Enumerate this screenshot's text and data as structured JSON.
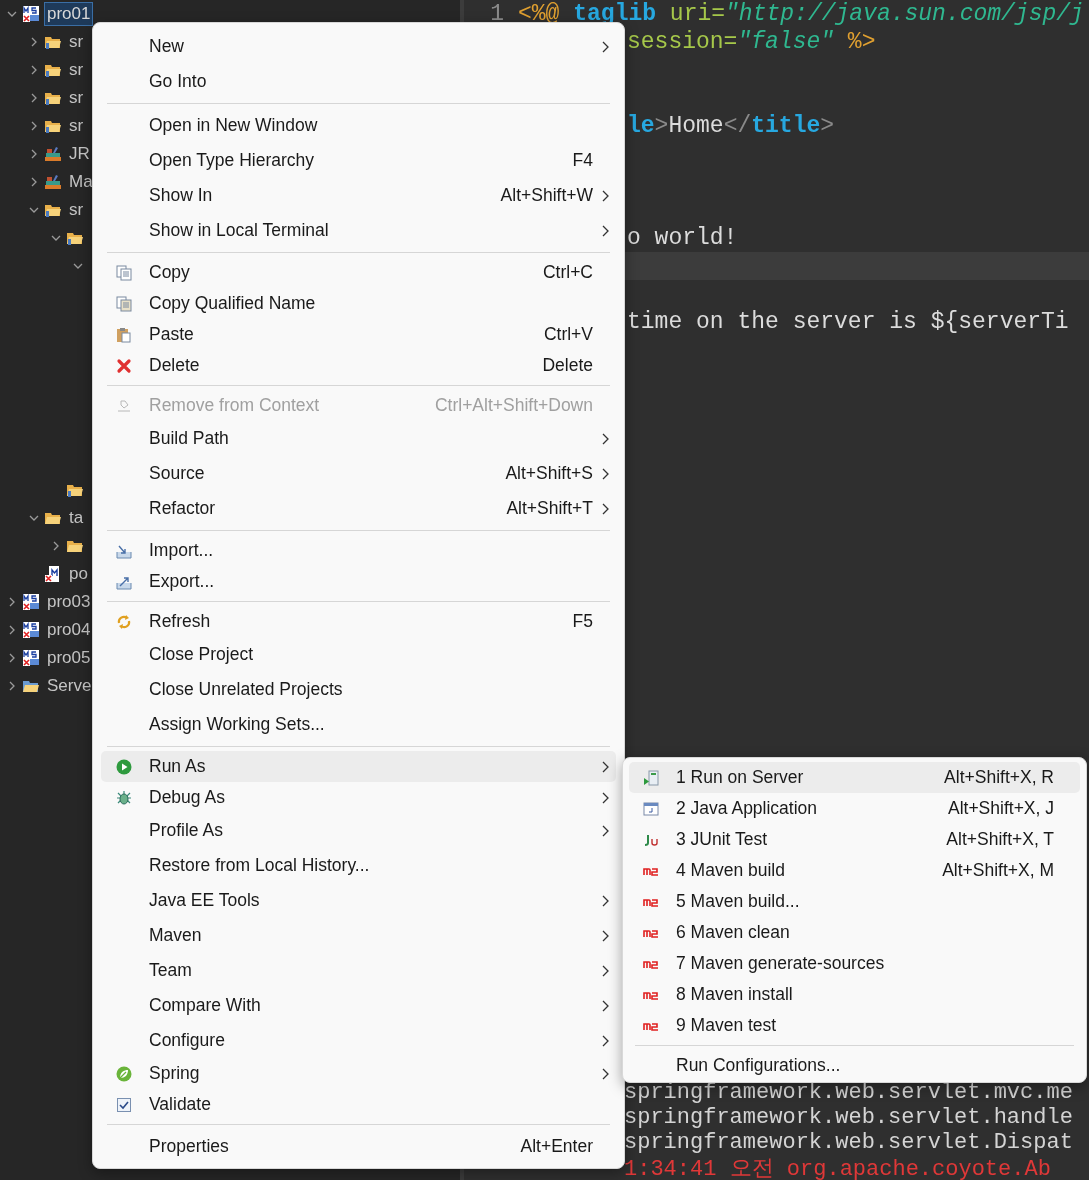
{
  "tree": [
    {
      "label": "pro01",
      "kind": "project",
      "expanded": true,
      "selected": true,
      "children": [
        {
          "label": "sr",
          "kind": "package-folder",
          "expanded": false,
          "selected": false
        },
        {
          "label": "sr",
          "kind": "package-folder",
          "expanded": false,
          "selected": false
        },
        {
          "label": "sr",
          "kind": "package-folder",
          "expanded": false,
          "selected": false
        },
        {
          "label": "sr",
          "kind": "package-folder",
          "expanded": false,
          "selected": false
        },
        {
          "label": "JR",
          "kind": "library",
          "expanded": false,
          "selected": false
        },
        {
          "label": "Ma",
          "kind": "library",
          "expanded": false,
          "selected": false
        },
        {
          "label": "sr",
          "kind": "package-folder",
          "expanded": true,
          "selected": false,
          "children": [
            {
              "kind": "package-folder",
              "expanded": true,
              "children": [
                {
                  "expanded": true
                }
              ]
            },
            {
              "kind": "package-folder"
            }
          ]
        },
        {
          "label": "ta",
          "kind": "folder",
          "expanded": true,
          "selected": false,
          "children": [
            {
              "kind": "folder",
              "expanded": false
            }
          ]
        },
        {
          "label": "po",
          "kind": "pom",
          "selected": false
        }
      ]
    },
    {
      "label": "pro03",
      "kind": "project",
      "expanded": false,
      "selected": false
    },
    {
      "label": "pro04",
      "kind": "project",
      "expanded": false,
      "selected": false
    },
    {
      "label": "pro05",
      "kind": "project",
      "expanded": false,
      "selected": false
    },
    {
      "label": "Serve",
      "kind": "servers",
      "expanded": false,
      "selected": false
    }
  ],
  "editor": {
    "lines": [
      {
        "number": "1",
        "current": false,
        "tokens": [
          {
            "text": "<%@",
            "kind": "delim"
          },
          {
            "text": " taglib",
            "kind": "keyword"
          },
          {
            "text": " uri=",
            "kind": "attr"
          },
          {
            "text": "\"http://java.sun.com/jsp/j",
            "kind": "string"
          }
        ]
      },
      {
        "current": false,
        "tokens": [
          {
            "text": "session=",
            "kind": "attr"
          },
          {
            "text": "\"false\"",
            "kind": "string"
          },
          {
            "text": " %>",
            "kind": "delim"
          }
        ]
      },
      {
        "current": false
      },
      {
        "current": false
      },
      {
        "current": false,
        "tokens": [
          {
            "text": "le",
            "kind": "keyword"
          },
          {
            "text": ">",
            "kind": "punct"
          },
          {
            "text": "Home",
            "kind": "plain"
          },
          {
            "text": "</",
            "kind": "punct"
          },
          {
            "text": "title",
            "kind": "keyword"
          },
          {
            "text": ">",
            "kind": "punct"
          }
        ]
      },
      {
        "current": false
      },
      {
        "current": false
      },
      {
        "current": false
      },
      {
        "current": false,
        "tokens": [
          {
            "text": "o world!",
            "kind": "plain"
          }
        ]
      },
      {
        "current": true
      },
      {
        "current": false
      },
      {
        "current": false,
        "tokens": [
          {
            "text": "time on the server is ${serverTi",
            "kind": "plain"
          }
        ]
      }
    ]
  },
  "console": {
    "lines": [
      {
        "text": "springframework.web.servlet.mvc.me",
        "kind": "info"
      },
      {
        "text": "springframework.web.servlet.handle",
        "kind": "info"
      },
      {
        "text": "springframework.web.servlet.Dispat",
        "kind": "info"
      },
      {
        "text": "1:34:41 오전 org.apache.coyote.Ab",
        "kind": "error"
      }
    ]
  },
  "context_menu": {
    "sections": [
      [
        {
          "label": "New",
          "submenu": true,
          "disabled": false,
          "selected": false,
          "kind": "none"
        },
        {
          "label": "Go Into",
          "submenu": false,
          "disabled": false,
          "selected": false,
          "kind": "none"
        }
      ],
      [
        {
          "label": "Open in New Window",
          "submenu": false,
          "disabled": false,
          "selected": false,
          "kind": "none"
        },
        {
          "label": "Open Type Hierarchy",
          "shortcut": "F4",
          "submenu": false,
          "disabled": false,
          "selected": false,
          "kind": "none"
        },
        {
          "label": "Show In",
          "shortcut": "Alt+Shift+W",
          "submenu": true,
          "disabled": false,
          "selected": false,
          "kind": "none"
        },
        {
          "label": "Show in Local Terminal",
          "submenu": true,
          "disabled": false,
          "selected": false,
          "kind": "none"
        }
      ],
      [
        {
          "label": "Copy",
          "shortcut": "Ctrl+C",
          "submenu": false,
          "disabled": false,
          "selected": false,
          "kind": "copy"
        },
        {
          "label": "Copy Qualified Name",
          "submenu": false,
          "disabled": false,
          "selected": false,
          "kind": "copy-name"
        },
        {
          "label": "Paste",
          "shortcut": "Ctrl+V",
          "submenu": false,
          "disabled": false,
          "selected": false,
          "kind": "paste"
        },
        {
          "label": "Delete",
          "shortcut": "Delete",
          "submenu": false,
          "disabled": false,
          "selected": false,
          "kind": "delete"
        }
      ],
      [
        {
          "label": "Remove from Context",
          "shortcut": "Ctrl+Alt+Shift+Down",
          "submenu": false,
          "disabled": true,
          "selected": false,
          "kind": "remove"
        },
        {
          "label": "Build Path",
          "submenu": true,
          "disabled": false,
          "selected": false,
          "kind": "none"
        },
        {
          "label": "Source",
          "shortcut": "Alt+Shift+S",
          "submenu": true,
          "disabled": false,
          "selected": false,
          "kind": "none"
        },
        {
          "label": "Refactor",
          "shortcut": "Alt+Shift+T",
          "submenu": true,
          "disabled": false,
          "selected": false,
          "kind": "none"
        }
      ],
      [
        {
          "label": "Import...",
          "submenu": false,
          "disabled": false,
          "selected": false,
          "kind": "import"
        },
        {
          "label": "Export...",
          "submenu": false,
          "disabled": false,
          "selected": false,
          "kind": "export"
        }
      ],
      [
        {
          "label": "Refresh",
          "shortcut": "F5",
          "submenu": false,
          "disabled": false,
          "selected": false,
          "kind": "refresh"
        },
        {
          "label": "Close Project",
          "submenu": false,
          "disabled": false,
          "selected": false,
          "kind": "none"
        },
        {
          "label": "Close Unrelated Projects",
          "submenu": false,
          "disabled": false,
          "selected": false,
          "kind": "none"
        },
        {
          "label": "Assign Working Sets...",
          "submenu": false,
          "disabled": false,
          "selected": false,
          "kind": "none"
        }
      ],
      [
        {
          "label": "Run As",
          "submenu": true,
          "disabled": false,
          "selected": true,
          "kind": "run"
        },
        {
          "label": "Debug As",
          "submenu": true,
          "disabled": false,
          "selected": false,
          "kind": "debug"
        },
        {
          "label": "Profile As",
          "submenu": true,
          "disabled": false,
          "selected": false,
          "kind": "none"
        },
        {
          "label": "Restore from Local History...",
          "submenu": false,
          "disabled": false,
          "selected": false,
          "kind": "none"
        },
        {
          "label": "Java EE Tools",
          "submenu": true,
          "disabled": false,
          "selected": false,
          "kind": "none"
        },
        {
          "label": "Maven",
          "submenu": true,
          "disabled": false,
          "selected": false,
          "kind": "none"
        },
        {
          "label": "Team",
          "submenu": true,
          "disabled": false,
          "selected": false,
          "kind": "none"
        },
        {
          "label": "Compare With",
          "submenu": true,
          "disabled": false,
          "selected": false,
          "kind": "none"
        },
        {
          "label": "Configure",
          "submenu": true,
          "disabled": false,
          "selected": false,
          "kind": "none"
        },
        {
          "label": "Spring",
          "submenu": true,
          "disabled": false,
          "selected": false,
          "kind": "spring"
        },
        {
          "label": "Validate",
          "submenu": false,
          "disabled": false,
          "selected": false,
          "kind": "validate"
        }
      ],
      [
        {
          "label": "Properties",
          "shortcut": "Alt+Enter",
          "submenu": false,
          "disabled": false,
          "selected": false,
          "kind": "none"
        }
      ]
    ]
  },
  "run_as_menu": {
    "sections": [
      [
        {
          "label": "1 Run on Server",
          "shortcut": "Alt+Shift+X, R",
          "selected": true,
          "kind": "server"
        },
        {
          "label": "2 Java Application",
          "shortcut": "Alt+Shift+X, J",
          "selected": false,
          "kind": "java"
        },
        {
          "label": "3 JUnit Test",
          "shortcut": "Alt+Shift+X, T",
          "selected": false,
          "kind": "junit"
        },
        {
          "label": "4 Maven build",
          "shortcut": "Alt+Shift+X, M",
          "selected": false,
          "kind": "maven"
        },
        {
          "label": "5 Maven build...",
          "selected": false,
          "kind": "maven"
        },
        {
          "label": "6 Maven clean",
          "selected": false,
          "kind": "maven"
        },
        {
          "label": "7 Maven generate-sources",
          "selected": false,
          "kind": "maven"
        },
        {
          "label": "8 Maven install",
          "selected": false,
          "kind": "maven"
        },
        {
          "label": "9 Maven test",
          "selected": false,
          "kind": "maven"
        }
      ],
      [
        {
          "label": "Run Configurations...",
          "selected": false,
          "kind": "none"
        }
      ]
    ]
  }
}
